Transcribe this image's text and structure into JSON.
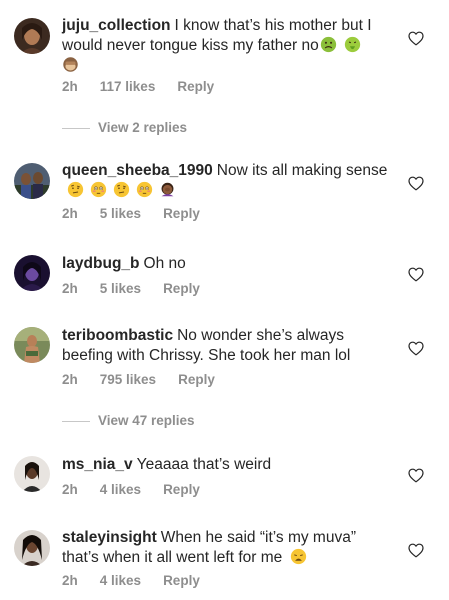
{
  "comments": [
    {
      "username": "juju_collection",
      "text": "I know that’s his mother but I would never tongue kiss my father no",
      "emojis": [
        "nauseated-face",
        "vomiting-face",
        "see-no-evil-monkey"
      ],
      "time": "2h",
      "likes": "117 likes",
      "reply": "Reply",
      "view_replies": "View 2 replies"
    },
    {
      "username": "queen_sheeba_1990",
      "text": "Now its all making sense",
      "emojis": [
        "face-with-raised-eyebrow",
        "flushed-face",
        "face-with-raised-eyebrow",
        "flushed-face",
        "woman-facepalming"
      ],
      "time": "2h",
      "likes": "5 likes",
      "reply": "Reply"
    },
    {
      "username": "laydbug_b",
      "text": "Oh no",
      "time": "2h",
      "likes": "5 likes",
      "reply": "Reply"
    },
    {
      "username": "teriboombastic",
      "text": "No wonder she’s always beefing with Chrissy. She took her man lol",
      "time": "2h",
      "likes": "795 likes",
      "reply": "Reply",
      "view_replies": "View 47 replies"
    },
    {
      "username": "ms_nia_v",
      "text": "Yeaaaa that’s weird",
      "time": "2h",
      "likes": "4 likes",
      "reply": "Reply"
    },
    {
      "username": "staleyinsight",
      "text": "When he said “it’s my muva” that’s when it all went left for me",
      "emojis": [
        "weary-face"
      ],
      "time": "2h",
      "likes": "4 likes",
      "reply": "Reply"
    }
  ],
  "icons": {
    "like": "heart-outline-icon"
  },
  "colors": {
    "text": "#262626",
    "secondary": "#8e8e8e",
    "divider": "#c7c7c7"
  }
}
